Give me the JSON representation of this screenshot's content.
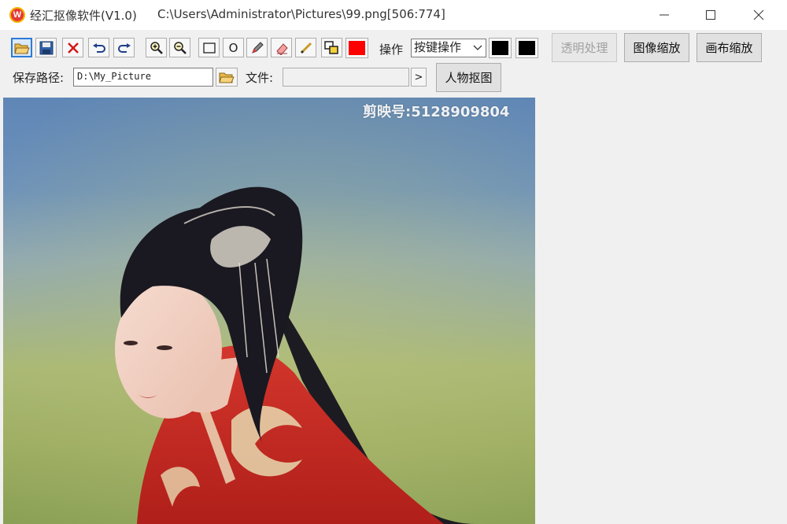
{
  "window": {
    "app_title": "经汇抠像软件(V1.0)",
    "file_title": "C:\\Users\\Administrator\\Pictures\\99.png[506:774]",
    "app_icon_letter": "W"
  },
  "toolbar": {
    "operation_label": "操作",
    "operation_mode": "按键操作",
    "circle_label": "O",
    "colors": {
      "pen": "#ff0000",
      "swatch1": "#000000",
      "swatch2": "#000000"
    },
    "buttons": {
      "transparent": "透明处理",
      "image_scale": "图像缩放",
      "canvas_scale": "画布缩放",
      "person_cutout": "人物抠图"
    }
  },
  "save_row": {
    "path_label": "保存路径:",
    "path_value": "D:\\My_Picture",
    "file_label": "文件:",
    "file_value": "",
    "next_label": ">"
  },
  "canvas": {
    "watermark": "剪映号:5128909804"
  }
}
